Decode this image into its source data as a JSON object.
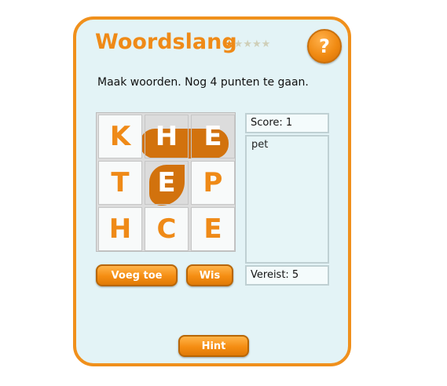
{
  "game": {
    "title": "Woordslang",
    "stars": {
      "filled": 1,
      "total": 5
    },
    "help_label": "?",
    "instruction": "Maak woorden. Nog 4 punten te gaan.",
    "score_label": "Score: 1",
    "required_label": "Vereist: 5"
  },
  "grid": {
    "rows": [
      [
        {
          "letter": "K",
          "selected": false
        },
        {
          "letter": "H",
          "selected": true
        },
        {
          "letter": "E",
          "selected": true
        }
      ],
      [
        {
          "letter": "T",
          "selected": false
        },
        {
          "letter": "E",
          "selected": true
        },
        {
          "letter": "P",
          "selected": false
        }
      ],
      [
        {
          "letter": "H",
          "selected": false
        },
        {
          "letter": "C",
          "selected": false
        },
        {
          "letter": "E",
          "selected": false
        }
      ]
    ]
  },
  "found_words": [
    "pet"
  ],
  "buttons": {
    "add": "Voeg toe",
    "clear": "Wis",
    "hint": "Hint"
  },
  "colors": {
    "accent": "#ef8a17",
    "selection": "#d2720d",
    "panel_bg": "#e3f3f6"
  }
}
